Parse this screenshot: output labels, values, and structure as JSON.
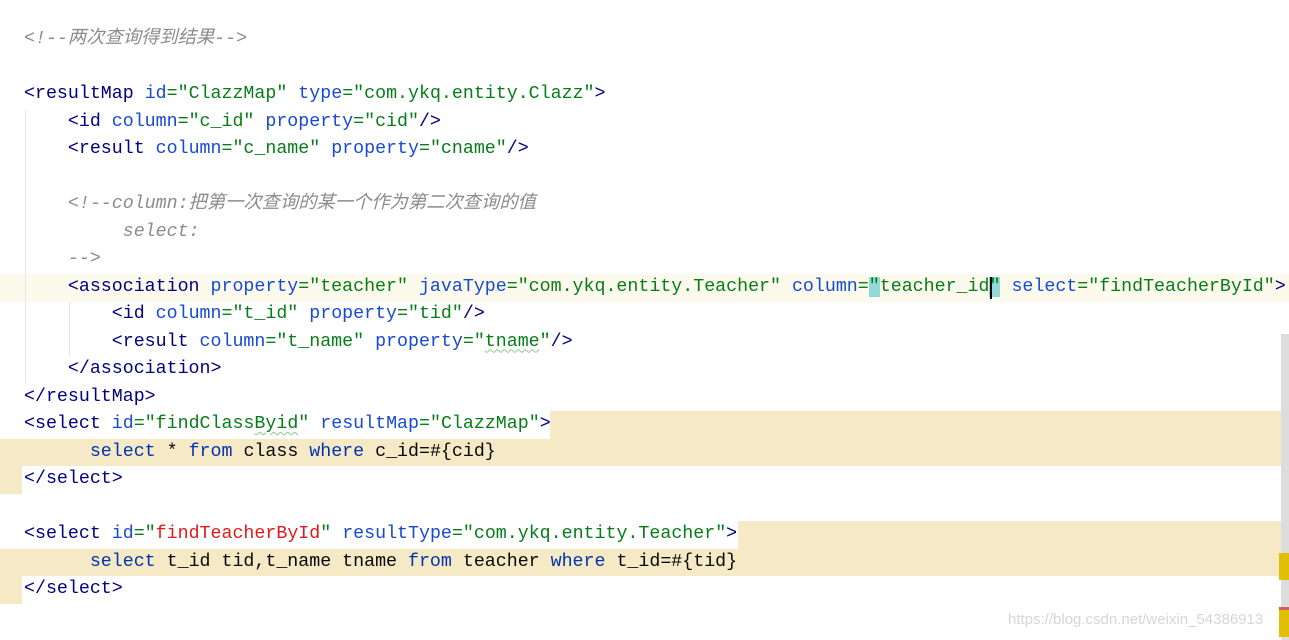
{
  "colors": {
    "tag": "#000080",
    "attribute": "#174ad4",
    "value": "#067d17",
    "comment": "#8c8c8c",
    "keyword": "#0033b3",
    "highlight": "#f5e9c6",
    "brace_match": "#93d9d9"
  },
  "lines": [
    [
      [
        "<!--两次查询得到结果-->",
        "cmt"
      ]
    ],
    [],
    [
      [
        "<resultMap ",
        "tag"
      ],
      [
        "id",
        "attr"
      ],
      [
        "=\"ClazzMap\" ",
        "val"
      ],
      [
        "type",
        "attr"
      ],
      [
        "=\"com.ykq.entity.Clazz\"",
        "val"
      ],
      [
        ">",
        "tag"
      ]
    ],
    [
      [
        "    <id ",
        "tag"
      ],
      [
        "column",
        "attr"
      ],
      [
        "=\"c_id\" ",
        "val"
      ],
      [
        "property",
        "attr"
      ],
      [
        "=\"cid\"",
        "val"
      ],
      [
        "/>",
        "tag"
      ]
    ],
    [
      [
        "    <result ",
        "tag"
      ],
      [
        "column",
        "attr"
      ],
      [
        "=\"c_name\" ",
        "val"
      ],
      [
        "property",
        "attr"
      ],
      [
        "=\"cname\"",
        "val"
      ],
      [
        "/>",
        "tag"
      ]
    ],
    [],
    [
      [
        "    <!--column:把第一次查询的某一个作为第二次查询的值",
        "cmt"
      ]
    ],
    [
      [
        "         select:",
        "cmt"
      ]
    ],
    [
      [
        "    -->",
        "cmt"
      ]
    ],
    [
      [
        "    <association ",
        "tag"
      ],
      [
        "property",
        "attr"
      ],
      [
        "=\"teacher\" ",
        "val"
      ],
      [
        "javaType",
        "attr"
      ],
      [
        "=\"com.ykq.entity.Teacher\" ",
        "val"
      ],
      [
        "column",
        "attr"
      ],
      [
        "=",
        "val"
      ],
      [
        "\"",
        "val brace"
      ],
      [
        "teacher_id",
        "val"
      ],
      [
        "\"",
        "val brace"
      ],
      [
        " ",
        "val"
      ],
      [
        "select",
        "attr"
      ],
      [
        "=\"findTeacherById\"",
        "val"
      ],
      [
        ">",
        "tag"
      ]
    ],
    [
      [
        "        <id ",
        "tag"
      ],
      [
        "column",
        "attr"
      ],
      [
        "=\"t_id\" ",
        "val"
      ],
      [
        "property",
        "attr"
      ],
      [
        "=\"tid\"",
        "val"
      ],
      [
        "/>",
        "tag"
      ]
    ],
    [
      [
        "        <result ",
        "tag"
      ],
      [
        "column",
        "attr"
      ],
      [
        "=\"t_name\" ",
        "val"
      ],
      [
        "property",
        "attr"
      ],
      [
        "=\"",
        "val"
      ],
      [
        "tname",
        "val wavy"
      ],
      [
        "\"",
        "val"
      ],
      [
        "/>",
        "tag"
      ]
    ],
    [
      [
        "    </association>",
        "tag"
      ]
    ],
    [
      [
        "</resultMap>",
        "tag"
      ]
    ],
    [
      [
        "<select ",
        "tag"
      ],
      [
        "id",
        "attr"
      ],
      [
        "=\"findClass",
        "val"
      ],
      [
        "Byid",
        "val wavy"
      ],
      [
        "\" ",
        "val"
      ],
      [
        "resultMap",
        "attr"
      ],
      [
        "=\"ClazzMap\"",
        "val"
      ],
      [
        ">",
        "tag"
      ]
    ],
    [
      [
        "      select ",
        "kw"
      ],
      [
        "* ",
        "txt"
      ],
      [
        "from ",
        "kw"
      ],
      [
        "class ",
        "txt"
      ],
      [
        "where ",
        "kw"
      ],
      [
        "c_id=#{cid}",
        "txt"
      ]
    ],
    [
      [
        "</select>",
        "tag"
      ]
    ],
    [],
    [
      [
        "<select ",
        "tag"
      ],
      [
        "id",
        "attr"
      ],
      [
        "=\"",
        "val"
      ],
      [
        "findTeacherById",
        "valred"
      ],
      [
        "\" ",
        "val"
      ],
      [
        "resultType",
        "attr"
      ],
      [
        "=\"com.ykq.entity.Teacher\"",
        "val"
      ],
      [
        ">",
        "tag"
      ]
    ],
    [
      [
        "      select ",
        "kw"
      ],
      [
        "t_id tid,t_name tname ",
        "txt"
      ],
      [
        "from ",
        "kw"
      ],
      [
        "teacher ",
        "txt"
      ],
      [
        "where ",
        "kw"
      ],
      [
        "t_id=#{tid}",
        "txt"
      ]
    ],
    [
      [
        "</select>",
        "tag"
      ]
    ]
  ],
  "watermark": "https://blog.csdn.net/weixin_54386913"
}
